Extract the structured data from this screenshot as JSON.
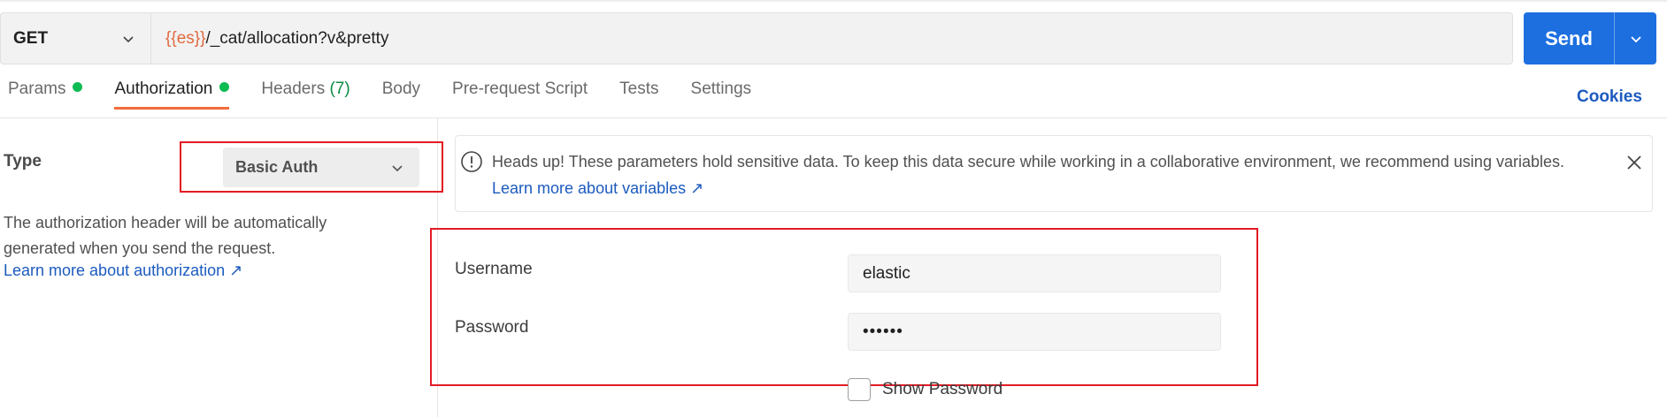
{
  "request": {
    "method": "GET",
    "url_variable": "{{es}}",
    "url_path": "/_cat/allocation?v&pretty",
    "send_label": "Send"
  },
  "tabs": [
    {
      "label": "Params",
      "has_dot": true,
      "active": false
    },
    {
      "label": "Authorization",
      "has_dot": true,
      "active": true
    },
    {
      "label": "Headers",
      "count": "(7)",
      "active": false
    },
    {
      "label": "Body",
      "active": false
    },
    {
      "label": "Pre-request Script",
      "active": false
    },
    {
      "label": "Tests",
      "active": false
    },
    {
      "label": "Settings",
      "active": false
    }
  ],
  "cookies_label": "Cookies",
  "auth": {
    "type_label": "Type",
    "type_value": "Basic Auth",
    "description": "The authorization header will be automatically generated when you send the request.",
    "learn_more": "Learn more about authorization ↗"
  },
  "banner": {
    "text": "Heads up! These parameters hold sensitive data. To keep this data secure while working in a collaborative environment, we recommend using variables.",
    "link": "Learn more about variables ↗"
  },
  "credentials": {
    "username_label": "Username",
    "username_value": "elastic",
    "password_label": "Password",
    "password_value": "••••••",
    "show_password_label": "Show Password"
  },
  "colors": {
    "send_button": "#1d6fe0",
    "active_tab_underline": "#f26b3a",
    "status_dot": "#0cbb52",
    "link": "#1c5bbf",
    "highlight_box": "#e21b23"
  },
  "icons": [
    "chevron-down-icon",
    "info-circle-icon",
    "close-icon",
    "checkbox-icon"
  ]
}
